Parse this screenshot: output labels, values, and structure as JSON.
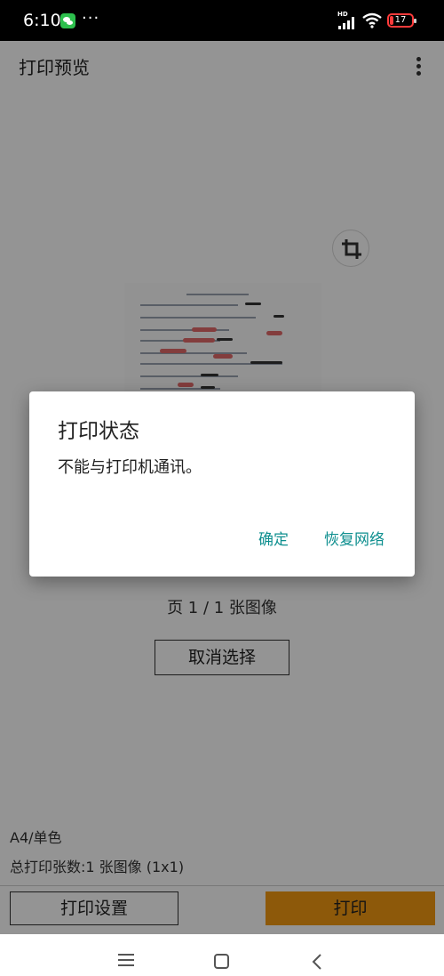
{
  "status_bar": {
    "time": "6:10",
    "dots": "···",
    "network_tag": "HD",
    "battery": "17"
  },
  "app_bar": {
    "title": "打印预览"
  },
  "preview": {
    "page_info": "页 1 / 1 张图像",
    "clear_selection_label": "取消选择"
  },
  "summary": {
    "paper": "A4/单色",
    "total": "总打印张数:1 张图像 (1x1)"
  },
  "bottom_bar": {
    "settings_label": "打印设置",
    "print_label": "打印"
  },
  "dialog": {
    "title": "打印状态",
    "message": "不能与打印机通讯。",
    "ok_label": "确定",
    "restore_label": "恢复网络"
  },
  "colors": {
    "accent": "#0e8f8f",
    "print_button": "#f39a12",
    "battery_low": "#ff3b3b"
  },
  "icons": [
    "wechat-icon",
    "signal-icon",
    "wifi-icon",
    "battery-icon",
    "overflow-menu-icon",
    "crop-icon",
    "nav-menu-icon",
    "nav-home-icon",
    "nav-back-icon"
  ]
}
